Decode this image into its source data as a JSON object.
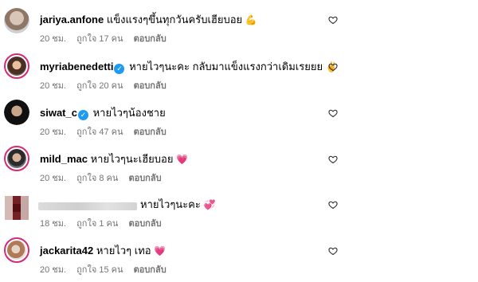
{
  "comments": [
    {
      "username": "jariya.anfone",
      "verified": false,
      "text": "แข็งแรงๆขึ้นทุกวันครับเฮียบอย",
      "emoji": "💪",
      "time": "20 ชม.",
      "likes": "ถูกใจ 17 คน",
      "reply": "ตอบกลับ"
    },
    {
      "username": "myriabenedetti",
      "verified": true,
      "text": "หายไวๆนะคะ กลับมาแข็งแรงกว่าเดิมเรยยย",
      "emoji": "✌️",
      "time": "20 ชม.",
      "likes": "ถูกใจ 20 คน",
      "reply": "ตอบกลับ"
    },
    {
      "username": "siwat_c",
      "verified": true,
      "text": "หายไวๆน้องชาย",
      "emoji": "",
      "time": "20 ชม.",
      "likes": "ถูกใจ 47 คน",
      "reply": "ตอบกลับ"
    },
    {
      "username": "mild_mac",
      "verified": false,
      "text": "หายไวๆนะเฮียบอย",
      "emoji": "💗",
      "time": "20 ชม.",
      "likes": "ถูกใจ 8 คน",
      "reply": "ตอบกลับ"
    },
    {
      "username": "",
      "verified": false,
      "text": "หายไวๆนะคะ",
      "emoji": "💞",
      "time": "18 ชม.",
      "likes": "ถูกใจ 1 คน",
      "reply": "ตอบกลับ"
    },
    {
      "username": "jackarita42",
      "verified": false,
      "text": "หายไวๆ เทอ",
      "emoji": "💗",
      "time": "20 ชม.",
      "likes": "ถูกใจ 15 คน",
      "reply": "ตอบกลับ"
    }
  ],
  "icons": {
    "like": "heart-outline-icon",
    "verified": "verified-badge-icon"
  }
}
